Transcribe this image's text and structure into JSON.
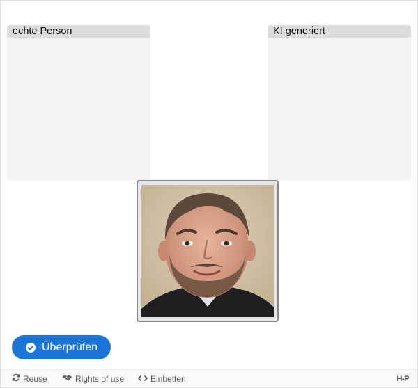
{
  "dropzones": [
    {
      "label": "echte Person"
    },
    {
      "label": "KI generiert"
    }
  ],
  "draggable": {
    "image_icon": "portrait-photo-icon"
  },
  "check_button": {
    "label": "Überprüfen",
    "icon": "check-circle-icon",
    "color": "#1a73d9"
  },
  "footer": {
    "reuse_label": "Reuse",
    "reuse_icon": "refresh-icon",
    "rights_label": "Rights of use",
    "rights_icon": "handshake-icon",
    "embed_label": "Einbetten",
    "embed_icon": "code-icon",
    "logo_text": "H-P"
  }
}
